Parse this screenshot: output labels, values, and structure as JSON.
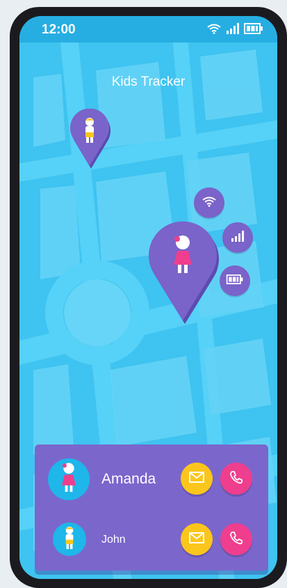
{
  "status_bar": {
    "time": "12:00",
    "icons": [
      "wifi-icon",
      "signal-icon",
      "battery-icon"
    ]
  },
  "app": {
    "title": "Kids Tracker"
  },
  "map": {
    "pins": [
      {
        "child": "boy",
        "color": "#7a63c9"
      },
      {
        "child": "girl",
        "color": "#7a63c9",
        "status_icons": [
          "wifi-icon",
          "signal-icon",
          "battery-icon"
        ]
      }
    ]
  },
  "contacts": [
    {
      "name": "Amanda",
      "child": "girl",
      "actions": [
        "mail-icon",
        "phone-icon"
      ]
    },
    {
      "name": "John",
      "child": "boy",
      "actions": [
        "mail-icon",
        "phone-icon"
      ]
    }
  ],
  "colors": {
    "map_background": "#3fc3f0",
    "accent_purple": "#7b66cc",
    "mail_button": "#fbc61b",
    "call_button": "#ef3e8e"
  }
}
